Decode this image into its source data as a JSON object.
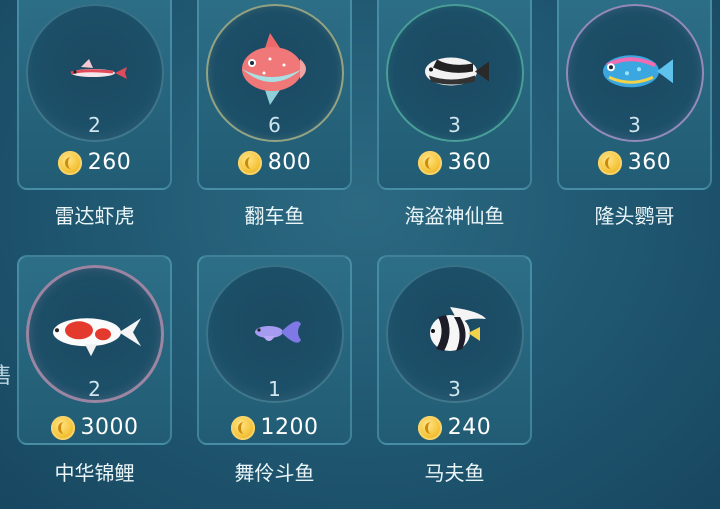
{
  "edge_label": "售",
  "fish": [
    {
      "name": "雷达虾虎",
      "count": "2",
      "price": "260",
      "icon": "goby-fish-icon"
    },
    {
      "name": "翻车鱼",
      "count": "6",
      "price": "800",
      "icon": "sunfish-icon"
    },
    {
      "name": "海盗神仙鱼",
      "count": "3",
      "price": "360",
      "icon": "angelfish-icon"
    },
    {
      "name": "隆头鹦哥",
      "count": "3",
      "price": "360",
      "icon": "parrotfish-icon"
    },
    {
      "name": "中华锦鲤",
      "count": "2",
      "price": "3000",
      "icon": "koi-fish-icon"
    },
    {
      "name": "舞伶斗鱼",
      "count": "1",
      "price": "1200",
      "icon": "betta-fish-icon"
    },
    {
      "name": "马夫鱼",
      "count": "3",
      "price": "240",
      "icon": "bannerfish-icon"
    }
  ],
  "colors": {
    "coin": "#f5c43a",
    "card": "#2d6f87",
    "background": "#1f5670"
  }
}
